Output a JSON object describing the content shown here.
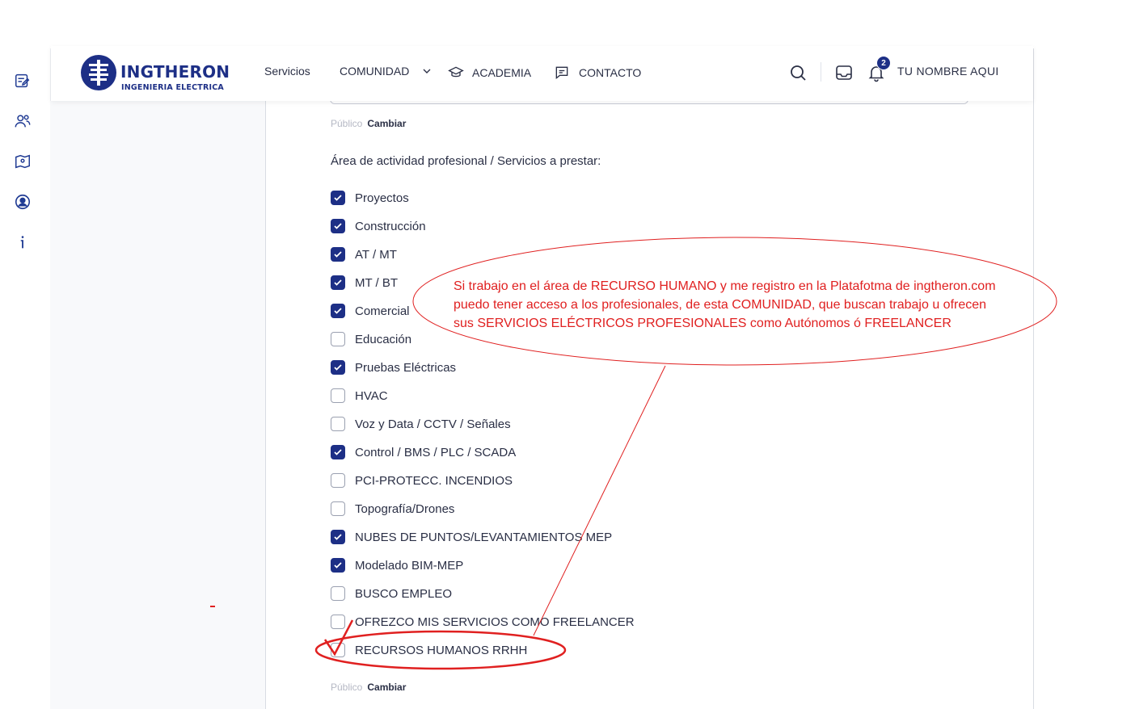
{
  "brand": {
    "title": "INGTHERON",
    "subtitle": "INGENIERIA ELECTRICA"
  },
  "nav": {
    "servicios": "Servicios",
    "comunidad": "COMUNIDAD",
    "academia": "ACADEMIA",
    "contacto": "CONTACTO"
  },
  "header": {
    "notification_count": "2",
    "user_name": "TU NOMBRE AQUI"
  },
  "rail_icons": [
    "edit-list-icon",
    "users-icon",
    "map-icon",
    "user-circle-icon",
    "info-icon"
  ],
  "visibility_top": {
    "scope": "Público",
    "action": "Cambiar"
  },
  "visibility_bottom": {
    "scope": "Público",
    "action": "Cambiar"
  },
  "section": {
    "label": "Área de actividad profesional / Servicios a prestar:"
  },
  "options": [
    {
      "label": "Proyectos",
      "checked": true
    },
    {
      "label": "Construcción",
      "checked": true
    },
    {
      "label": "AT / MT",
      "checked": true
    },
    {
      "label": "MT / BT",
      "checked": true
    },
    {
      "label": "Comercial",
      "checked": true
    },
    {
      "label": "Educación",
      "checked": false
    },
    {
      "label": "Pruebas Eléctricas",
      "checked": true
    },
    {
      "label": "HVAC",
      "checked": false
    },
    {
      "label": "Voz y Data / CCTV / Señales",
      "checked": false
    },
    {
      "label": "Control / BMS / PLC / SCADA",
      "checked": true
    },
    {
      "label": "PCI-PROTECC. INCENDIOS",
      "checked": false
    },
    {
      "label": "Topografía/Drones",
      "checked": false
    },
    {
      "label": "NUBES DE PUNTOS/LEVANTAMIENTOS MEP",
      "checked": true
    },
    {
      "label": "Modelado BIM-MEP",
      "checked": true
    },
    {
      "label": "BUSCO EMPLEO",
      "checked": false
    },
    {
      "label": "OFREZCO MIS SERVICIOS COMO FREELANCER",
      "checked": false
    },
    {
      "label": "RECURSOS HUMANOS RRHH",
      "checked": false
    }
  ],
  "annotation": {
    "line1": "Si trabajo en el área de RECURSO HUMANO y me registro en la Platafotma de ingtheron.com",
    "line2": "puedo tener acceso a los profesionales, de esta COMUNIDAD, que buscan trabajo u ofrecen",
    "line3": "sus SERVICIOS ELÉCTRICOS PROFESIONALES  como Autónomos ó FREELANCER",
    "color": "#e02020"
  },
  "colors": {
    "brand": "#1d2f86",
    "text": "#2a2f45",
    "muted": "#b5b8c4"
  }
}
